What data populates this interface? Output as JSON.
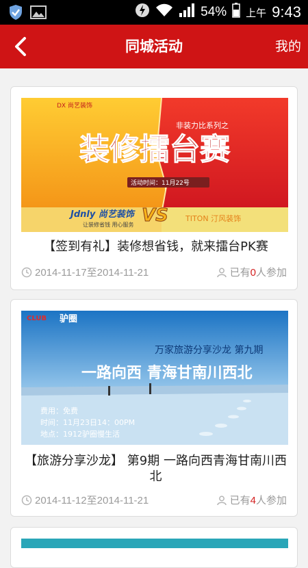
{
  "statusbar": {
    "battery": "54%",
    "ampm": "上午",
    "time": "9:43"
  },
  "header": {
    "title": "同城活动",
    "mine": "我的"
  },
  "activities": [
    {
      "title": "【签到有礼】装修想省钱，就来擂台PK赛",
      "date": "2014-11-17至2014-11-21",
      "join_prefix": "已有",
      "join_count": "0",
      "join_suffix": "人参加",
      "banner": {
        "headline": "装修擂台赛",
        "series": "非装力比系列之",
        "time_label": "活动时间：11月22号",
        "left_brand": "Jdnly 尚艺装饰",
        "left_slogan": "让装修省钱 用心服务",
        "right_brand": "TITON 汀风装饰",
        "vs": "VS"
      }
    },
    {
      "title": "【旅游分享沙龙】 第9期 一路向西青海甘南川西北",
      "date": "2014-11-12至2014-11-21",
      "join_prefix": "已有",
      "join_count": "4",
      "join_suffix": "人参加",
      "banner": {
        "subtitle": "万家旅游分享沙龙 第九期",
        "headline": "一路向西 青海甘南川西北",
        "fee": "费用：免费",
        "time": "时间：11月23日14：00PM",
        "place": "地点：1912驴圈慢生活",
        "logo": "驴圈"
      }
    }
  ],
  "colors": {
    "header_red": "#cf1415",
    "count_red": "#d32020"
  }
}
